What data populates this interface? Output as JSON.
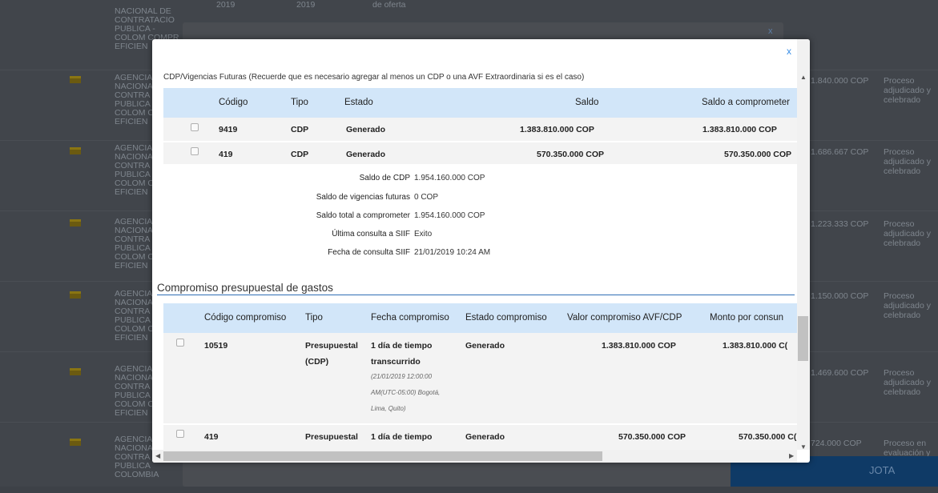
{
  "background": {
    "rows": [
      {
        "entity": "NACIONAL DE CONTRATACIO PUBLICA - COLOM COMPR EFICIEN",
        "value": "",
        "state": ""
      },
      {
        "entity": "AGENCIA NACIONAL CONTRA PUBLICA COLOM COMPR EFICIEN",
        "value": "1.840.000 COP",
        "state": "Proceso adjudicado y celebrado"
      },
      {
        "entity": "AGENCIA NACIONAL CONTRA PUBLICA COLOM COMPR EFICIEN",
        "value": "1.686.667 COP",
        "state": "Proceso adjudicado y celebrado"
      },
      {
        "entity": "AGENCIA NACIONAL CONTRA PUBLICA COLOM COMPR EFICIEN",
        "value": "1.223.333 COP",
        "state": "Proceso adjudicado y celebrado"
      },
      {
        "entity": "AGENCIA NACIONAL CONTRA PUBLICA COLOM COMPR EFICIEN",
        "value": "1.150.000 COP",
        "state": "Proceso adjudicado y celebrado"
      },
      {
        "entity": "AGENCIA NACIONAL CONTRA PUBLICA COLOM COMPR EFICIEN",
        "value": "1.469.600 COP",
        "state": "Proceso adjudicado y celebrado"
      },
      {
        "entity": "AGENCIA NACIONAL CONTRA PUBLICA COLOMBIA",
        "value": "724.000 COP",
        "state": "Proceso en evaluación y"
      }
    ],
    "top_texts": [
      "2019",
      "2019",
      "de oferta"
    ],
    "blue_button": "JOTA",
    "back_close": "x"
  },
  "modal": {
    "close": "x",
    "cdp_title": "CDP/Vigencias Futuras (Recuerde que es necesario agregar al menos un CDP o una AVF Extraordinaria si es el caso)",
    "cdp_headers": {
      "codigo": "Código",
      "tipo": "Tipo",
      "estado": "Estado",
      "saldo": "Saldo",
      "saldo_comp": "Saldo a comprometer"
    },
    "cdp_rows": [
      {
        "codigo": "9419",
        "tipo": "CDP",
        "estado": "Generado",
        "saldo": "1.383.810.000 COP",
        "saldo_comp": "1.383.810.000 COP"
      },
      {
        "codigo": "419",
        "tipo": "CDP",
        "estado": "Generado",
        "saldo": "570.350.000 COP",
        "saldo_comp": "570.350.000 COP"
      }
    ],
    "summary": [
      {
        "label": "Saldo de CDP",
        "value": "1.954.160.000 COP"
      },
      {
        "label": "Saldo de vigencias futuras",
        "value": "0 COP"
      },
      {
        "label": "Saldo total a comprometer",
        "value": "1.954.160.000 COP"
      },
      {
        "label": "Última consulta a SIIF",
        "value": "Exito"
      },
      {
        "label": "Fecha de consulta SIIF",
        "value": "21/01/2019 10:24 AM"
      }
    ],
    "comp_title": "Compromiso presupuestal de gastos",
    "comp_headers": {
      "codigo": "Código compromiso",
      "tipo": "Tipo",
      "fecha": "Fecha compromiso",
      "estado": "Estado compromiso",
      "valor": "Valor compromiso AVF/CDP",
      "monto": "Monto por consun"
    },
    "comp_rows": [
      {
        "codigo": "10519",
        "tipo1": "Presupuestal",
        "tipo2": "(CDP)",
        "fecha1": "1 día de tiempo",
        "fecha2": "transcurrido",
        "fecha3": "(21/01/2019 12:00:00",
        "fecha4": "AM(UTC-05:00) Bogotá,",
        "fecha5": "Lima, Quito)",
        "estado": "Generado",
        "valor": "1.383.810.000 COP",
        "monto": "1.383.810.000 C("
      },
      {
        "codigo": "419",
        "tipo1": "Presupuestal",
        "fecha1": "1 día de tiempo",
        "estado": "Generado",
        "valor": "570.350.000 COP",
        "monto": "570.350.000 C("
      }
    ]
  }
}
